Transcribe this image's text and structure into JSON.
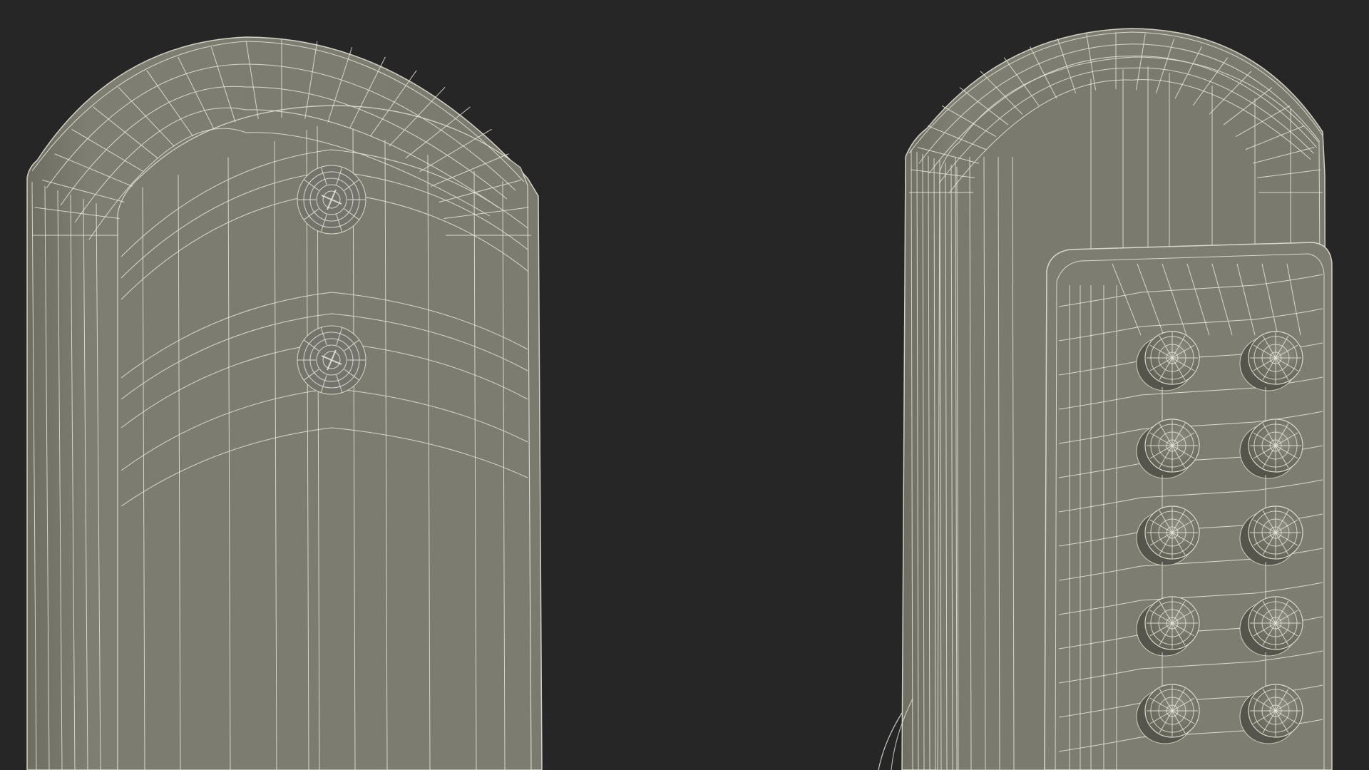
{
  "scene": {
    "background_color": "#262626",
    "surface_color": "#7b7b6f",
    "surface_shadow_color": "#6a6a5f",
    "wire_color": "#e8e8de",
    "objects": [
      {
        "name": "door-plate-back",
        "screws": 2
      },
      {
        "name": "keypad-lock-front",
        "buttons": 10
      }
    ]
  }
}
